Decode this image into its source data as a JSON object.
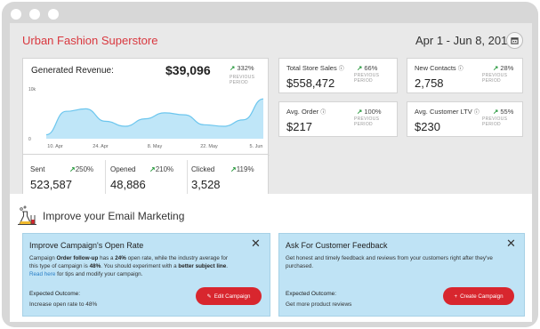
{
  "store_name": "Urban Fashion Superstore",
  "date_range": "Apr 1 - Jun 8, 2017",
  "icons": {
    "calendar": "calendar-icon",
    "trend": "arrow-up-right-icon",
    "info": "info-icon",
    "close": "close-icon",
    "lab": "lab-flask-icon",
    "edit": "pencil-icon",
    "plus": "plus-icon"
  },
  "colors": {
    "store": "#d9383f",
    "trend_up": "#2a9a3f",
    "chart_fill": "#bfe6f8",
    "chart_line": "#6cc6ee",
    "panel": "#bfe3f5",
    "button": "#d8262e"
  },
  "revenue": {
    "title": "Generated Revenue:",
    "value": "$39,096",
    "change": "332%",
    "previous": "PREVIOUS PERIOD"
  },
  "chart_data": {
    "type": "area",
    "x": [
      "10. Apr",
      "15. Apr",
      "20. Apr",
      "25. Apr",
      "30. Apr",
      "5. May",
      "10. May",
      "15. May",
      "20. May",
      "25. May",
      "30. May",
      "5. Jun"
    ],
    "x_tick_labels": [
      "10. Apr",
      "24. Apr",
      "8. May",
      "22. May",
      "5. Jun"
    ],
    "y": [
      0.8,
      5.5,
      6.0,
      3.5,
      2.5,
      4.0,
      5.2,
      4.8,
      2.8,
      2.5,
      3.8,
      8.0
    ],
    "y_tick_labels": [
      "10k",
      "0"
    ],
    "ylim": [
      0,
      10
    ],
    "grid": false
  },
  "stats": [
    {
      "label": "Sent",
      "change": "250%",
      "value": "523,587"
    },
    {
      "label": "Opened",
      "change": "210%",
      "value": "48,886"
    },
    {
      "label": "Clicked",
      "change": "119%",
      "value": "3,528"
    }
  ],
  "metrics": [
    {
      "label": "Total Store Sales",
      "change": "66%",
      "previous": "PREVIOUS PERIOD",
      "value": "$558,472"
    },
    {
      "label": "New Contacts",
      "change": "28%",
      "previous": "PREVIOUS PERIOD",
      "value": "2,758"
    },
    {
      "label": "Avg. Order",
      "change": "100%",
      "previous": "PREVIOUS PERIOD",
      "value": "$217"
    },
    {
      "label": "Avg. Customer LTV",
      "change": "55%",
      "previous": "PREVIOUS PERIOD",
      "value": "$230"
    }
  ],
  "email": {
    "title": "Improve your Email Marketing",
    "panels": [
      {
        "title": "Improve Campaign's Open Rate",
        "body_parts": [
          {
            "t": "Campaign "
          },
          {
            "t": "Order follow-up",
            "b": true
          },
          {
            "t": " has a "
          },
          {
            "t": "24%",
            "b": true
          },
          {
            "t": " open rate, while the industry average for this type of campaign is "
          },
          {
            "t": "48%",
            "b": true
          },
          {
            "t": ". You should experiment with a "
          },
          {
            "t": "better subject line",
            "b": true
          },
          {
            "t": ". "
          },
          {
            "t": "Read here",
            "a": true
          },
          {
            "t": " for tips and modify your campaign."
          }
        ],
        "outcome_label": "Expected Outcome:",
        "outcome_value": "Increase open rate to 48%",
        "button": "Edit Campaign"
      },
      {
        "title": "Ask For Customer Feedback",
        "body_parts": [
          {
            "t": "Get honest and timely feedback and reviews from your customers right after they've purchased."
          }
        ],
        "outcome_label": "Expected Outcome:",
        "outcome_value": "Get more product reviews",
        "button": "Create Campaign"
      }
    ]
  }
}
